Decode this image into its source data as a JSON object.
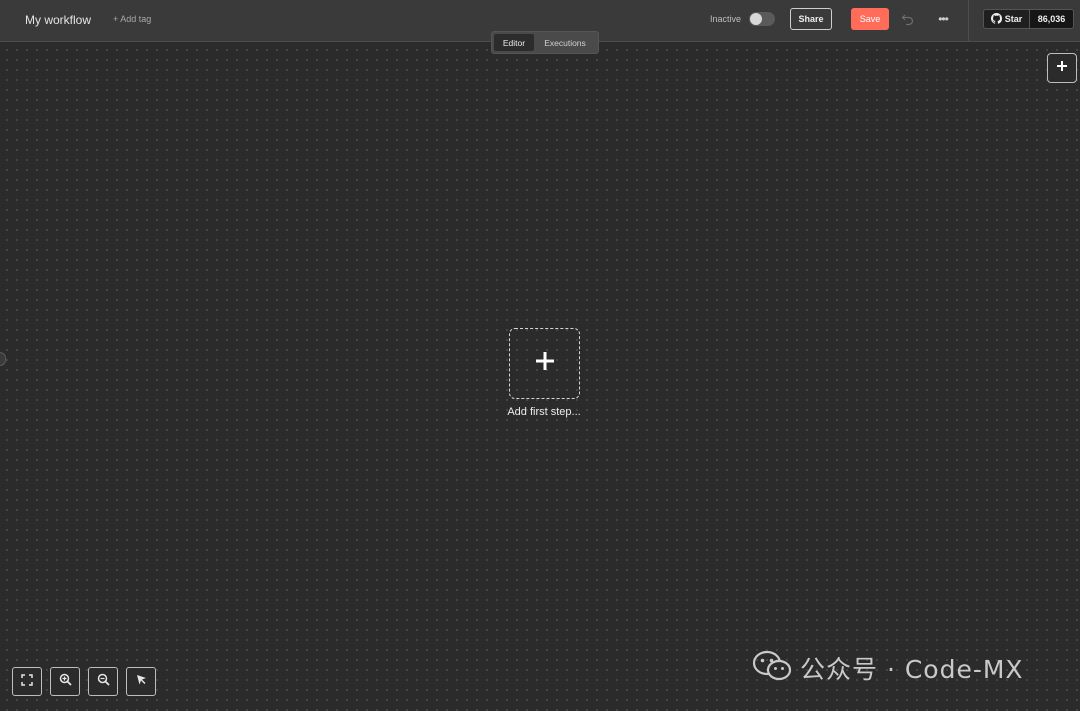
{
  "header": {
    "workflow_name": "My workflow",
    "add_tag": "+ Add tag",
    "active_status": "Inactive",
    "share_label": "Share",
    "save_label": "Save",
    "github": {
      "star_label": "Star",
      "star_count": "86,036"
    }
  },
  "tabs": [
    {
      "label": "Editor",
      "active": true
    },
    {
      "label": "Executions",
      "active": false
    }
  ],
  "canvas": {
    "first_step_label": "Add first step..."
  },
  "watermark": {
    "text": "公众号 · Code-MX"
  },
  "colors": {
    "accent": "#ff6d5a",
    "canvas_bg": "#2b2b2b",
    "header_bg": "#3a3a3a"
  },
  "icons": {
    "toggle": "toggle-off",
    "undo": "undo-icon",
    "more": "more-horizontal-icon",
    "github": "github-icon",
    "add_node": "plus-icon",
    "fit": "fit-view-icon",
    "zoom_in": "zoom-in-icon",
    "zoom_out": "zoom-out-icon",
    "cursor": "cursor-icon"
  }
}
